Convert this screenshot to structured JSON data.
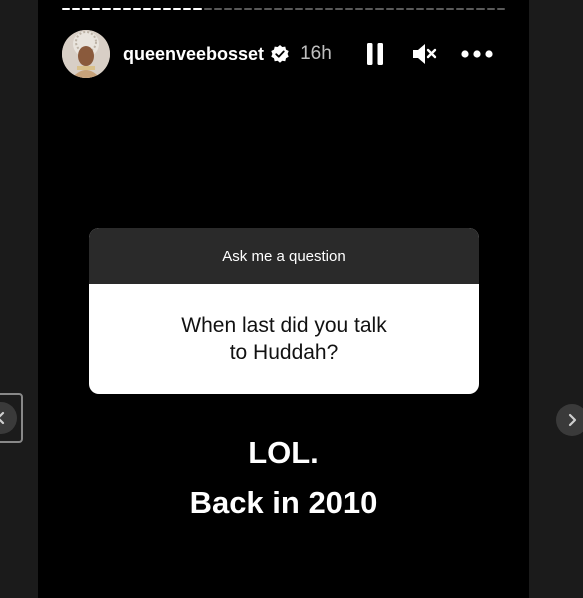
{
  "story": {
    "username": "queenveebosset",
    "time": "16h",
    "progress_segments_done": 14,
    "progress_segments_total": 44
  },
  "question_sticker": {
    "header": "Ask me a question",
    "question_line1": "When last did you talk",
    "question_line2": "to Huddah?"
  },
  "answer": {
    "line1": "LOL.",
    "line2": "Back in 2010"
  },
  "icons": {
    "verified": "verified-badge-icon",
    "pause": "pause-icon",
    "mute": "muted-speaker-icon",
    "more": "more-options-icon",
    "prev": "chevron-left-icon",
    "next": "chevron-right-icon"
  },
  "colors": {
    "story_background": "#000000",
    "page_background": "#1b1b1b",
    "sticker_header": "#2a2a2a",
    "sticker_body": "#ffffff"
  }
}
